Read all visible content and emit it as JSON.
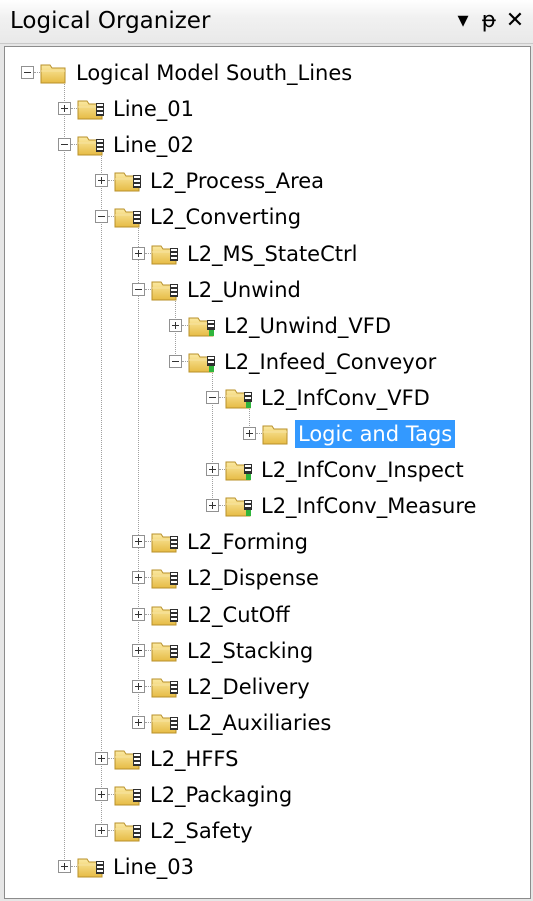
{
  "window": {
    "title": "Logical Organizer",
    "buttons": {
      "dropdown": "▾",
      "pin": "ᵽ",
      "close": "✕"
    }
  },
  "tree": {
    "root": "Logical Model South_Lines",
    "nodes": [
      {
        "label": "Line_01",
        "level": 1,
        "state": "collapsed",
        "icon": "area-folder-icon"
      },
      {
        "label": "Line_02",
        "level": 1,
        "state": "expanded",
        "icon": "area-folder-icon"
      },
      {
        "label": "L2_Process_Area",
        "level": 2,
        "state": "collapsed",
        "icon": "area-folder-icon"
      },
      {
        "label": "L2_Converting",
        "level": 2,
        "state": "expanded",
        "icon": "area-folder-icon"
      },
      {
        "label": "L2_MS_StateCtrl",
        "level": 3,
        "state": "collapsed",
        "icon": "area-folder-icon"
      },
      {
        "label": "L2_Unwind",
        "level": 3,
        "state": "expanded",
        "icon": "area-folder-icon"
      },
      {
        "label": "L2_Unwind_VFD",
        "level": 4,
        "state": "collapsed",
        "icon": "device-folder-icon"
      },
      {
        "label": "L2_Infeed_Conveyor",
        "level": 4,
        "state": "expanded",
        "icon": "device-folder-icon"
      },
      {
        "label": "L2_InfConv_VFD",
        "level": 5,
        "state": "expanded",
        "icon": "device-folder-icon"
      },
      {
        "label": "Logic and Tags",
        "level": 6,
        "state": "collapsed",
        "icon": "plain-folder-icon",
        "selected": true
      },
      {
        "label": "L2_InfConv_Inspect",
        "level": 5,
        "state": "collapsed",
        "icon": "device-folder-icon"
      },
      {
        "label": "L2_InfConv_Measure",
        "level": 5,
        "state": "collapsed",
        "icon": "device-folder-icon"
      },
      {
        "label": "L2_Forming",
        "level": 3,
        "state": "collapsed",
        "icon": "area-folder-icon"
      },
      {
        "label": "L2_Dispense",
        "level": 3,
        "state": "collapsed",
        "icon": "area-folder-icon"
      },
      {
        "label": "L2_CutOff",
        "level": 3,
        "state": "collapsed",
        "icon": "area-folder-icon"
      },
      {
        "label": "L2_Stacking",
        "level": 3,
        "state": "collapsed",
        "icon": "area-folder-icon"
      },
      {
        "label": "L2_Delivery",
        "level": 3,
        "state": "collapsed",
        "icon": "area-folder-icon"
      },
      {
        "label": "L2_Auxiliaries",
        "level": 3,
        "state": "collapsed",
        "icon": "area-folder-icon"
      },
      {
        "label": "L2_HFFS",
        "level": 2,
        "state": "collapsed",
        "icon": "area-folder-icon"
      },
      {
        "label": "L2_Packaging",
        "level": 2,
        "state": "collapsed",
        "icon": "area-folder-icon"
      },
      {
        "label": "L2_Safety",
        "level": 2,
        "state": "collapsed",
        "icon": "area-folder-icon"
      },
      {
        "label": "Line_03",
        "level": 1,
        "state": "collapsed",
        "icon": "area-folder-icon"
      }
    ]
  },
  "colors": {
    "selection": "#3399ff",
    "folder": "#f2d36b",
    "device_badge": "#3aa142"
  }
}
